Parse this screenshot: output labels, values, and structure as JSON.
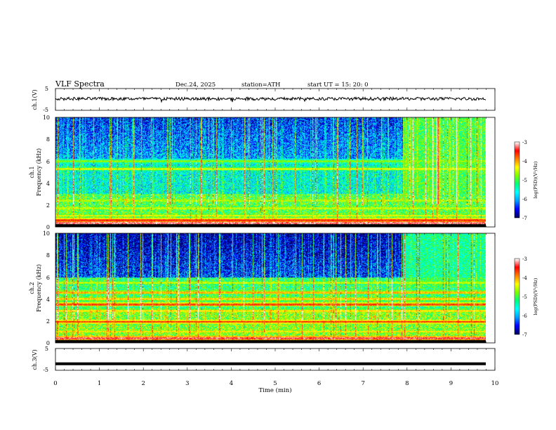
{
  "header": {
    "title": "VLF  Spectra",
    "date": "Dec.24, 2025",
    "station": "station=ATH",
    "start": "start  UT  =    15: 20: 0"
  },
  "colors": {
    "colormap": [
      "#000060",
      "#0000ff",
      "#00a0ff",
      "#00ffff",
      "#00ff80",
      "#80ff00",
      "#ffff00",
      "#ff8000",
      "#ff0000",
      "#ffffff"
    ]
  },
  "chart_data": [
    {
      "type": "line",
      "panel": "ch1-waveform",
      "ylabel": "ch.1(V)",
      "ylim": [
        -5,
        5
      ],
      "yticks": [
        "5",
        "-5"
      ],
      "xlim": [
        0,
        10
      ],
      "trend": "noisy waveform near +0.3 V",
      "grid": false
    },
    {
      "type": "heatmap",
      "panel": "ch1-spectrogram",
      "ylabel_top": "ch.1",
      "ylabel": "Frequency  (kHz)",
      "ylim": [
        0,
        10
      ],
      "yticks": [
        "0",
        "2",
        "4",
        "6",
        "8",
        "10"
      ],
      "xlim": [
        0,
        10
      ],
      "data_end_min": 9.8,
      "colorbar": {
        "label": "log(PSD)(V²/Hz)",
        "range": [
          -7,
          -3
        ],
        "ticks": [
          "-3",
          "-4",
          "-5",
          "-6",
          "-7"
        ]
      },
      "bands": [
        {
          "f": 0.3,
          "level": -3.2
        },
        {
          "f": 0.6,
          "level": -3.6
        },
        {
          "f": 1.0,
          "level": -4.4
        },
        {
          "f": 1.7,
          "level": -4.6
        },
        {
          "f": 2.4,
          "level": -4.7
        },
        {
          "f": 5.3,
          "level": -4.5
        },
        {
          "f": 6.0,
          "level": -4.8
        }
      ],
      "noise_floor": {
        "low_freq": -5.0,
        "mid_freq": -5.6,
        "high_freq": -6.0
      },
      "late_enhancement": {
        "from_min": 7.9,
        "freq_band": [
          3,
          10
        ],
        "level": -5.0
      }
    },
    {
      "type": "heatmap",
      "panel": "ch2-spectrogram",
      "ylabel_top": "ch.2",
      "ylabel": "Frequency  (kHz)",
      "ylim": [
        0,
        10
      ],
      "yticks": [
        "0",
        "2",
        "4",
        "6",
        "8",
        "10"
      ],
      "xlim": [
        0,
        10
      ],
      "data_end_min": 9.8,
      "colorbar": {
        "label": "log(PSD)(V²/Hz)",
        "range": [
          -7,
          -3
        ],
        "ticks": [
          "-3",
          "-4",
          "-5",
          "-6",
          "-7"
        ]
      },
      "bands": [
        {
          "f": 0.4,
          "level": -3.3
        },
        {
          "f": 1.0,
          "level": -4.3
        },
        {
          "f": 1.9,
          "level": -3.6
        },
        {
          "f": 2.9,
          "level": -4.3
        },
        {
          "f": 3.5,
          "level": -3.7
        },
        {
          "f": 4.0,
          "level": -4.2
        },
        {
          "f": 4.6,
          "level": -4.1
        },
        {
          "f": 5.5,
          "level": -4.6
        }
      ],
      "noise_floor": {
        "low_freq": -4.8,
        "mid_freq": -5.2,
        "high_freq": -6.4
      },
      "late_enhancement": {
        "from_min": 7.9,
        "freq_band": [
          5,
          10
        ],
        "level": -5.3
      }
    },
    {
      "type": "line",
      "panel": "ch3-waveform",
      "ylabel": "ch.3(V)",
      "ylim": [
        -5,
        5
      ],
      "yticks": [
        "5",
        "-5"
      ],
      "xlim": [
        0,
        10
      ],
      "trend": "flat thick line near -2 V",
      "grid": false
    }
  ],
  "xaxis": {
    "label": "Time  (min)",
    "ticks": [
      "0",
      "1",
      "2",
      "3",
      "4",
      "5",
      "6",
      "7",
      "8",
      "9",
      "10"
    ]
  }
}
